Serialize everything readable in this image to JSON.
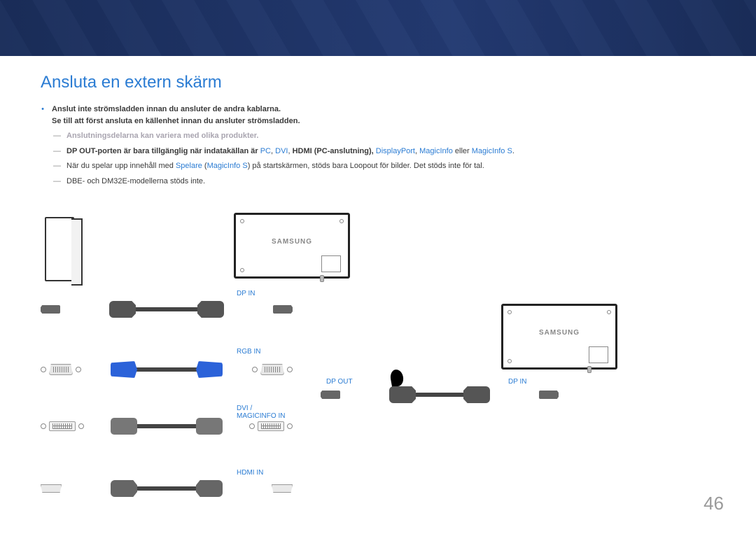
{
  "page_number": "46",
  "title": "Ansluta en extern skärm",
  "warning1": "Anslut inte strömsladden innan du ansluter de andra kablarna.",
  "warning2": "Se till att först ansluta en källenhet innan du ansluter strömsladden.",
  "note_vary": "Anslutningsdelarna kan variera med olika produkter.",
  "note_dpout_pre": "DP OUT",
  "note_dpout_mid": "-porten är bara tillgänglig när indatakällan är ",
  "tok_pc": "PC",
  "sep": ", ",
  "tok_dvi": "DVI",
  "tok_hdmi": "HDMI",
  "note_dpout_hdmi_paren": " (PC-anslutning), ",
  "tok_dp": "DisplayPort",
  "tok_mi": "MagicInfo",
  "word_eller": " eller ",
  "tok_mis": "MagicInfo S",
  "period": ".",
  "note_player_pre": "När du spelar upp innehåll med ",
  "tok_player": "Spelare",
  "note_player_paren": " (",
  "tok_mis2": "MagicInfo S",
  "note_player_post": ") på startskärmen, stöds bara Loopout för bilder. Det stöds inte för tal.",
  "note_dbe": "DBE- och DM32E-modellerna stöds inte.",
  "labels": {
    "dp_in": "DP IN",
    "rgb_in": "RGB IN",
    "dvi_magic": "DVI /\nMAGICINFO IN",
    "hdmi_in": "HDMI IN",
    "dp_out": "DP OUT",
    "dp_in2": "DP IN"
  },
  "brand": "SAMSUNG"
}
